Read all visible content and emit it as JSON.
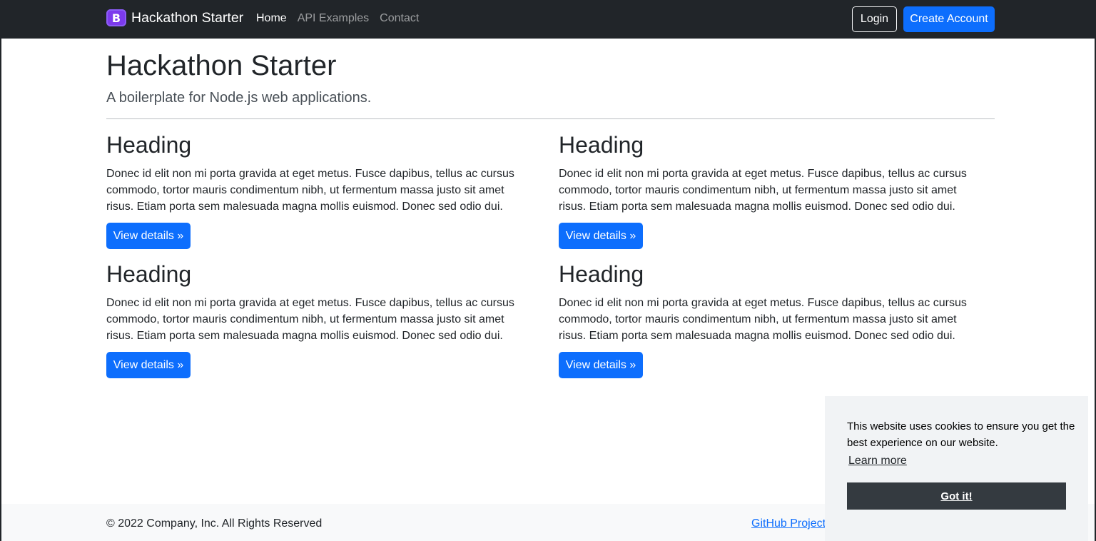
{
  "navbar": {
    "brand_letter": "B",
    "brand_name": "Hackathon Starter",
    "links": [
      "Home",
      "API Examples",
      "Contact"
    ],
    "login_label": "Login",
    "create_label": "Create Account"
  },
  "jumbotron": {
    "title": "Hackathon Starter",
    "lead": "A boilerplate for Node.js web applications."
  },
  "cards": [
    {
      "heading": "Heading",
      "body": "Donec id elit non mi porta gravida at eget metus. Fusce dapibus, tellus ac cursus commodo, tortor mauris condimentum nibh, ut fermentum massa justo sit amet risus. Etiam porta sem malesuada magna mollis euismod. Donec sed odio dui.",
      "button": "View details »"
    },
    {
      "heading": "Heading",
      "body": "Donec id elit non mi porta gravida at eget metus. Fusce dapibus, tellus ac cursus commodo, tortor mauris condimentum nibh, ut fermentum massa justo sit amet risus. Etiam porta sem malesuada magna mollis euismod. Donec sed odio dui.",
      "button": "View details »"
    },
    {
      "heading": "Heading",
      "body": "Donec id elit non mi porta gravida at eget metus. Fusce dapibus, tellus ac cursus commodo, tortor mauris condimentum nibh, ut fermentum massa justo sit amet risus. Etiam porta sem malesuada magna mollis euismod. Donec sed odio dui.",
      "button": "View details »"
    },
    {
      "heading": "Heading",
      "body": "Donec id elit non mi porta gravida at eget metus. Fusce dapibus, tellus ac cursus commodo, tortor mauris condimentum nibh, ut fermentum massa justo sit amet risus. Etiam porta sem malesuada magna mollis euismod. Donec sed odio dui.",
      "button": "View details »"
    }
  ],
  "footer": {
    "copyright": "© 2022 Company, Inc. All Rights Reserved",
    "github_link": "GitHub Project"
  },
  "cookie_banner": {
    "message": "This website uses cookies to ensure you get the best experience on our website.",
    "learn_more": "Learn more",
    "accept": "Got it!"
  },
  "colors": {
    "navbar_bg": "#212529",
    "primary": "#0d6efd",
    "brand_purple": "#7c3aed",
    "cookie_bg": "#f1f3f5",
    "cookie_button": "#343a40",
    "footer_bg": "#f8f9fa"
  }
}
